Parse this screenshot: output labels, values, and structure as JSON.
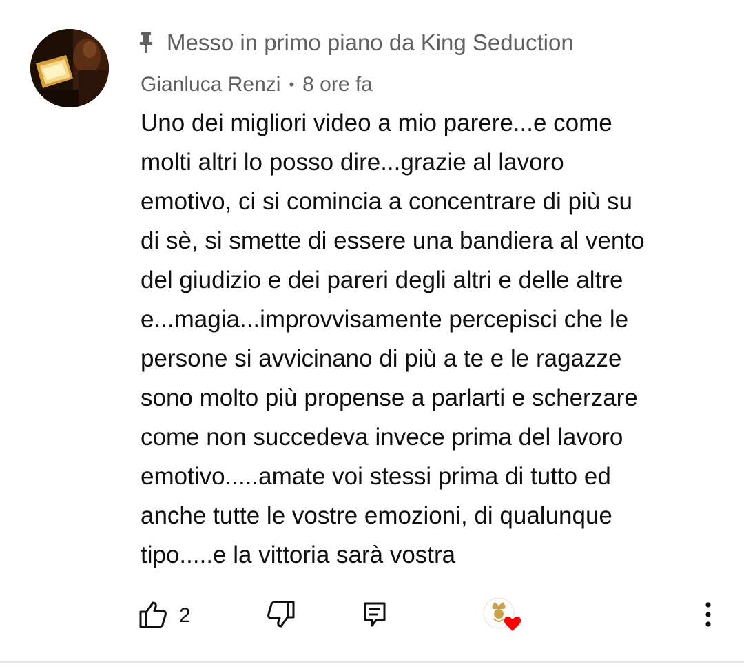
{
  "comment": {
    "pinned_text": "Messo in primo piano da King Seduction",
    "author": "Gianluca Renzi",
    "separator": "•",
    "timestamp": "8 ore fa",
    "body_lines": [
      "Uno dei migliori video a mio parere...e come",
      "molti altri lo posso dire...grazie al lavoro",
      "emotivo, ci si comincia a concentrare di più su",
      "di sè, si smette di essere una bandiera al vento",
      "del giudizio e dei pareri degli altri e delle altre",
      "e...magia...improvvisamente percepisci che le",
      "persone si avvicinano di più a te e le ragazze",
      "sono molto più propense a parlarti e scherzare",
      "come non succedeva invece prima del lavoro",
      "emotivo.....amate voi stessi prima di tutto ed",
      "anche tutte le vostre emozioni, di qualunque",
      "tipo.....e la vittoria sarà vostra"
    ]
  },
  "actions": {
    "like_icon": "thumb-up-icon",
    "like_count": "2",
    "dislike_icon": "thumb-down-icon",
    "reply_icon": "comment-reply-icon",
    "creator_heart_icon": "creator-heart-icon",
    "more_icon": "vertical-dots-icon"
  },
  "colors": {
    "text_primary": "#0f0f0f",
    "text_secondary": "#606060",
    "heart": "#ff0000",
    "divider": "#e5e5e5"
  }
}
